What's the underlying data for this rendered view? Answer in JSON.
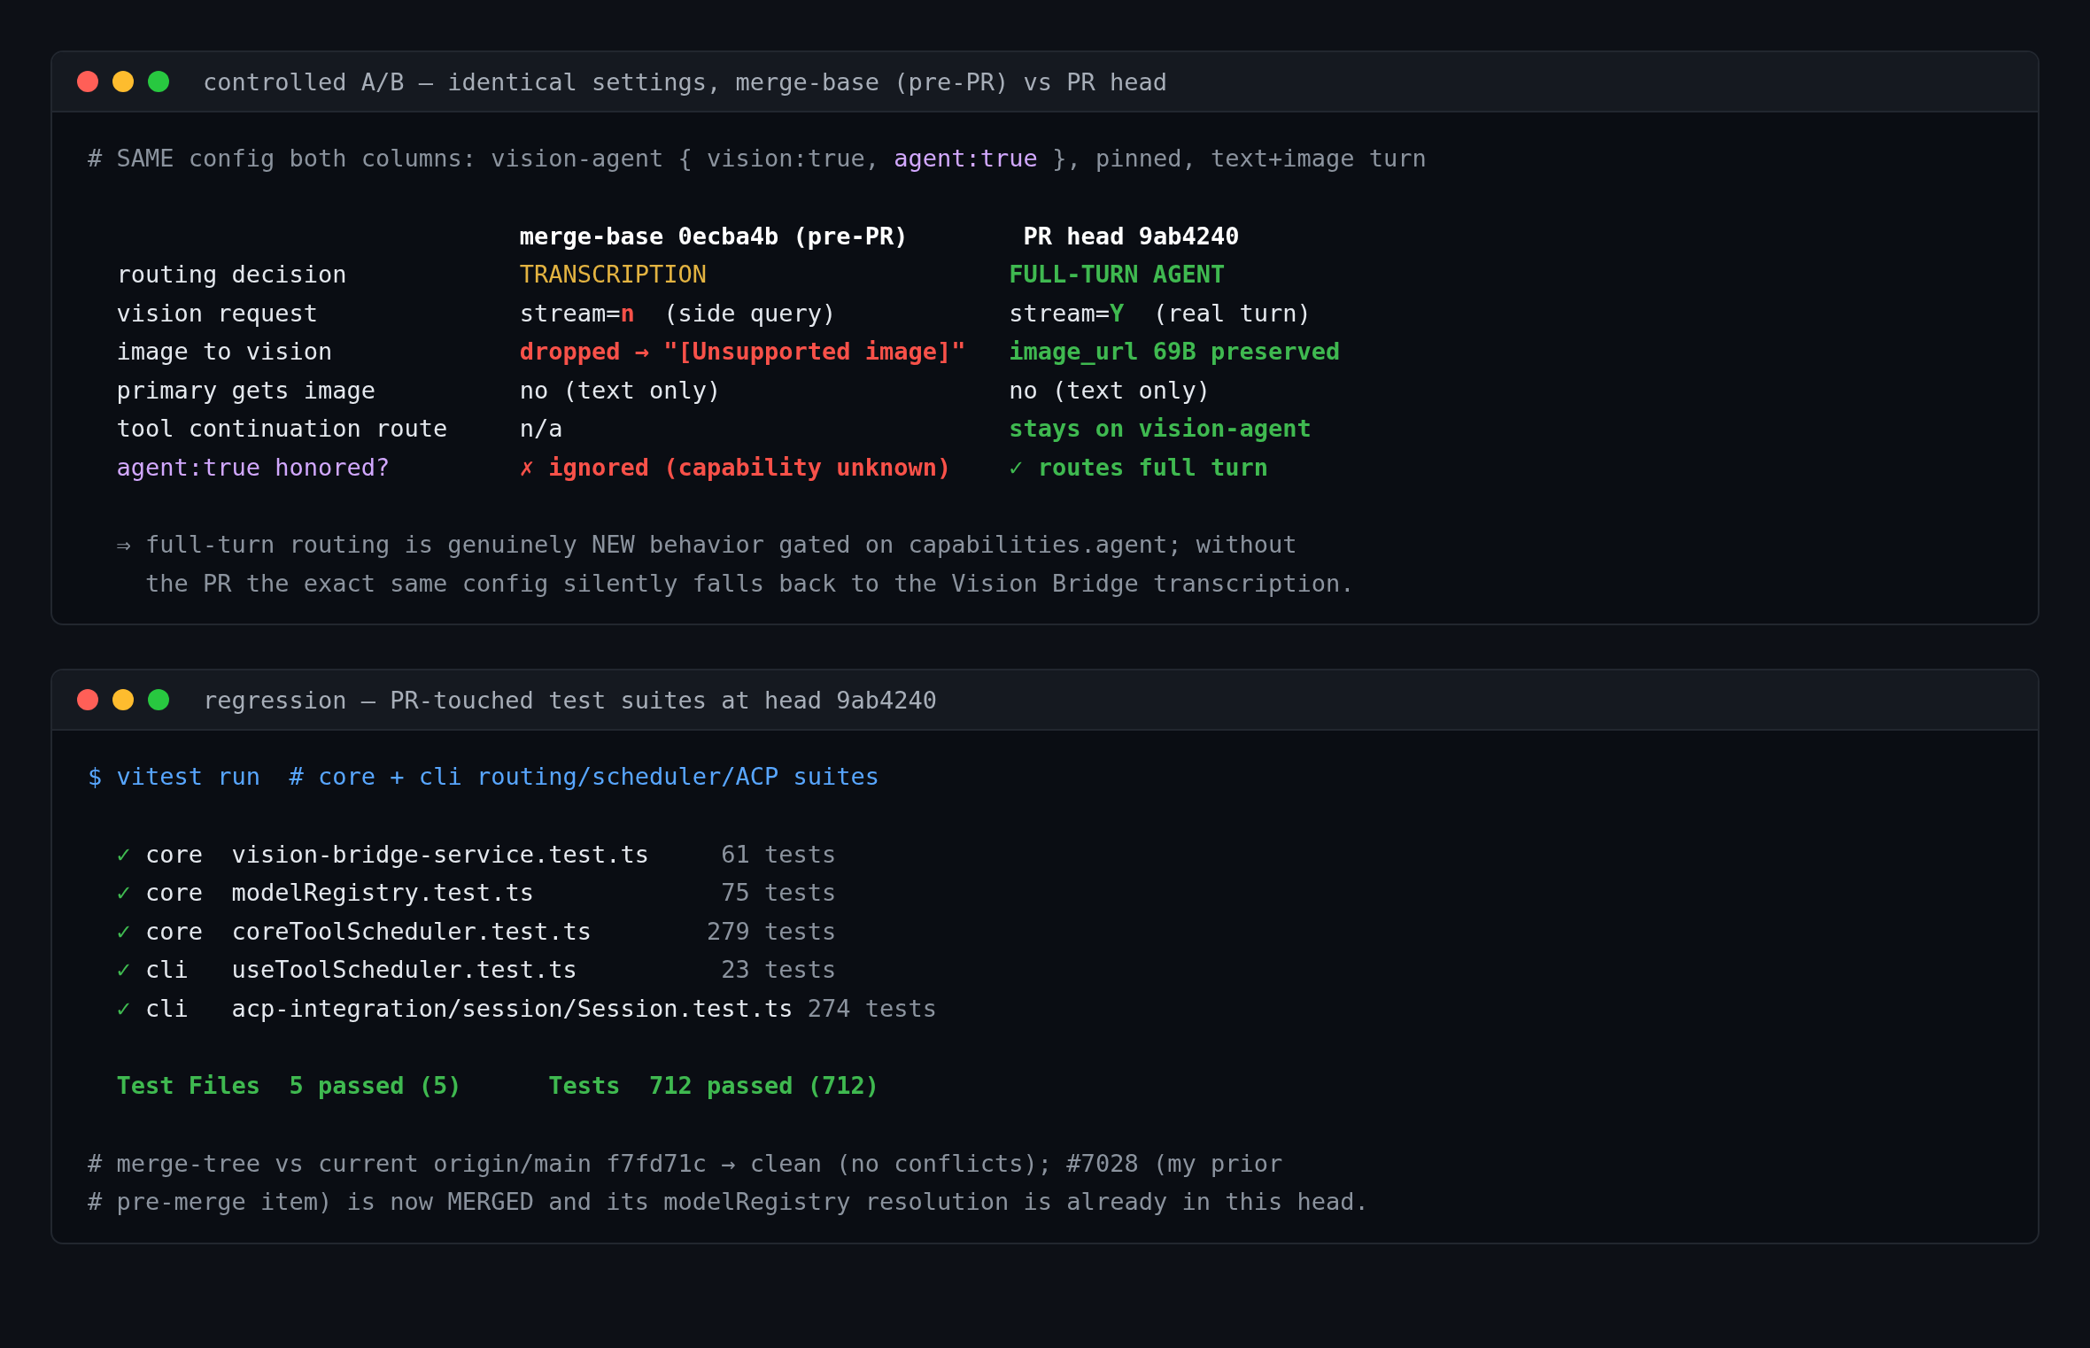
{
  "terminals": [
    {
      "title": "controlled A/B — identical settings, merge-base (pre-PR) vs PR head",
      "kind": "comparison",
      "comment": [
        {
          "text": "# SAME config both columns: vision-agent { vision:true, ",
          "kind": "muted"
        },
        {
          "text": "agent:true",
          "kind": "purple"
        },
        {
          "text": " }, pinned, text+image turn",
          "kind": "muted"
        }
      ],
      "columns": [
        "merge-base 0ecba4b (pre-PR)",
        "PR head 9ab4240"
      ],
      "rows": [
        {
          "label": {
            "text": "routing decision",
            "kind": "plain"
          },
          "cells": [
            [
              {
                "text": "TRANSCRIPTION",
                "kind": "yellow"
              }
            ],
            [
              {
                "text": "FULL-TURN AGENT",
                "kind": "green"
              }
            ]
          ]
        },
        {
          "label": {
            "text": "vision request",
            "kind": "plain"
          },
          "cells": [
            [
              {
                "text": "stream=",
                "kind": "plain"
              },
              {
                "text": "n",
                "kind": "error"
              },
              {
                "text": "  (side query)",
                "kind": "plain"
              }
            ],
            [
              {
                "text": "stream=",
                "kind": "plain"
              },
              {
                "text": "Y",
                "kind": "success"
              },
              {
                "text": "  (real turn)",
                "kind": "plain"
              }
            ]
          ]
        },
        {
          "label": {
            "text": "image to vision",
            "kind": "plain"
          },
          "cells": [
            [
              {
                "text": "dropped → \"[Unsupported image]\"",
                "kind": "error"
              }
            ],
            [
              {
                "text": "image_url 69B preserved",
                "kind": "success"
              }
            ]
          ]
        },
        {
          "label": {
            "text": "primary gets image",
            "kind": "plain"
          },
          "cells": [
            [
              {
                "text": "no (text only)",
                "kind": "plain"
              }
            ],
            [
              {
                "text": "no (text only)",
                "kind": "plain"
              }
            ]
          ]
        },
        {
          "label": {
            "text": "tool continuation route",
            "kind": "plain"
          },
          "cells": [
            [
              {
                "text": "n/a",
                "kind": "plain"
              }
            ],
            [
              {
                "text": "stays on vision-agent",
                "kind": "success"
              }
            ]
          ]
        },
        {
          "label": {
            "text": "agent:true honored?",
            "kind": "purple"
          },
          "cells": [
            [
              {
                "text": "✗ ignored (capability unknown)",
                "kind": "error"
              }
            ],
            [
              {
                "text": "✓ routes full turn",
                "kind": "success"
              }
            ]
          ]
        }
      ],
      "notes": [
        "⇒ full-turn routing is genuinely NEW behavior gated on capabilities.agent; without",
        "the PR the exact same config silently falls back to the Vision Bridge transcription."
      ]
    },
    {
      "title": "regression — PR-touched test suites at head 9ab4240",
      "kind": "tests",
      "command": "$ vitest run  # core + cli routing/scheduler/ACP suites",
      "suites": [
        {
          "passed": true,
          "package": "core",
          "file": "vision-bridge-service.test.ts",
          "count": "61",
          "unit": "tests"
        },
        {
          "passed": true,
          "package": "core",
          "file": "modelRegistry.test.ts",
          "count": "75",
          "unit": "tests"
        },
        {
          "passed": true,
          "package": "core",
          "file": "coreToolScheduler.test.ts",
          "count": "279",
          "unit": "tests"
        },
        {
          "passed": true,
          "package": "cli",
          "file": "useToolScheduler.test.ts",
          "count": "23",
          "unit": "tests"
        },
        {
          "passed": true,
          "package": "cli",
          "file": "acp-integration/session/Session.test.ts",
          "count": "274",
          "unit": "tests"
        }
      ],
      "check_mark": "✓",
      "summary": [
        {
          "label": "Test Files",
          "value": "5 passed (5)"
        },
        {
          "label": "Tests",
          "value": "712 passed (712)"
        }
      ],
      "footer": [
        "# merge-tree vs current origin/main f7fd71c → clean (no conflicts); #7028 (my prior",
        "# pre-merge item) is now MERGED and its modelRegistry resolution is already in this head."
      ]
    }
  ]
}
